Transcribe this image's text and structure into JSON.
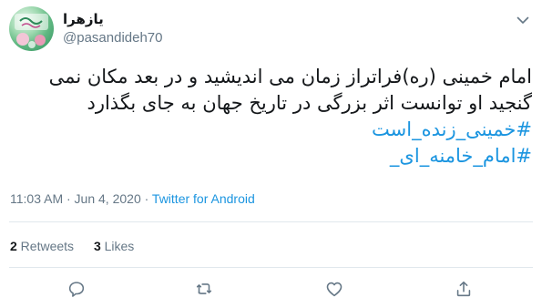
{
  "user": {
    "display_name": "یازهرا",
    "handle": "@pasandideh70"
  },
  "tweet": {
    "line1": "امام خمینی (ره)فراتراز زمان می اندیشید و در بعد مکان نمی",
    "line2": "گنجید او توانست اثر بزرگی در تاریخ جهان به جای بگذارد",
    "hashtag1": "#خمینی_زنده_است",
    "hashtag2": "#امام_خامنه_ای_"
  },
  "meta": {
    "time": "11:03 AM · Jun 4, 2020 · ",
    "source": "Twitter for Android"
  },
  "stats": {
    "retweets_count": "2",
    "retweets_label": " Retweets",
    "likes_count": "3",
    "likes_label": " Likes"
  },
  "colors": {
    "link": "#1b95e0",
    "secondary_text": "#657786",
    "divider": "#e1e8ed"
  },
  "icons": [
    "avatar",
    "chevron-down-icon",
    "reply-icon",
    "retweet-icon",
    "like-icon",
    "share-icon"
  ]
}
